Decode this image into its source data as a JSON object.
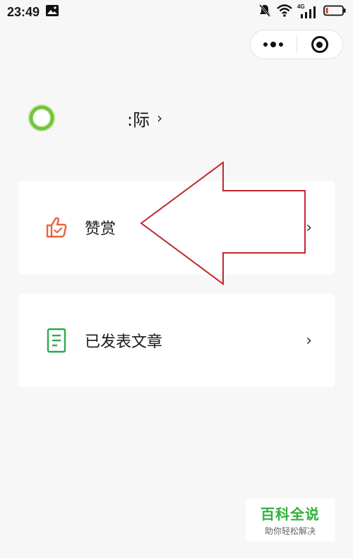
{
  "status_bar": {
    "time": "23:49",
    "network": "4G",
    "icons": [
      "image-icon",
      "mute-icon",
      "wifi-icon",
      "signal-icon",
      "battery-icon"
    ]
  },
  "capsule": {
    "more_icon": "more-dots-icon",
    "close_icon": "target-icon"
  },
  "profile": {
    "name": ":际",
    "chevron": "›"
  },
  "menu": [
    {
      "label": "赞赏",
      "icon": "thumbs-up-icon",
      "icon_color": "#e8633d",
      "chevron": "›"
    },
    {
      "label": "已发表文章",
      "icon": "document-icon",
      "icon_color": "#2fa84f",
      "chevron": "›"
    }
  ],
  "annotation": {
    "arrow_color": "#c0282d",
    "direction": "left"
  },
  "watermark": {
    "title": "百科全说",
    "subtitle": "助你轻松解决",
    "color": "#2fb23c"
  }
}
